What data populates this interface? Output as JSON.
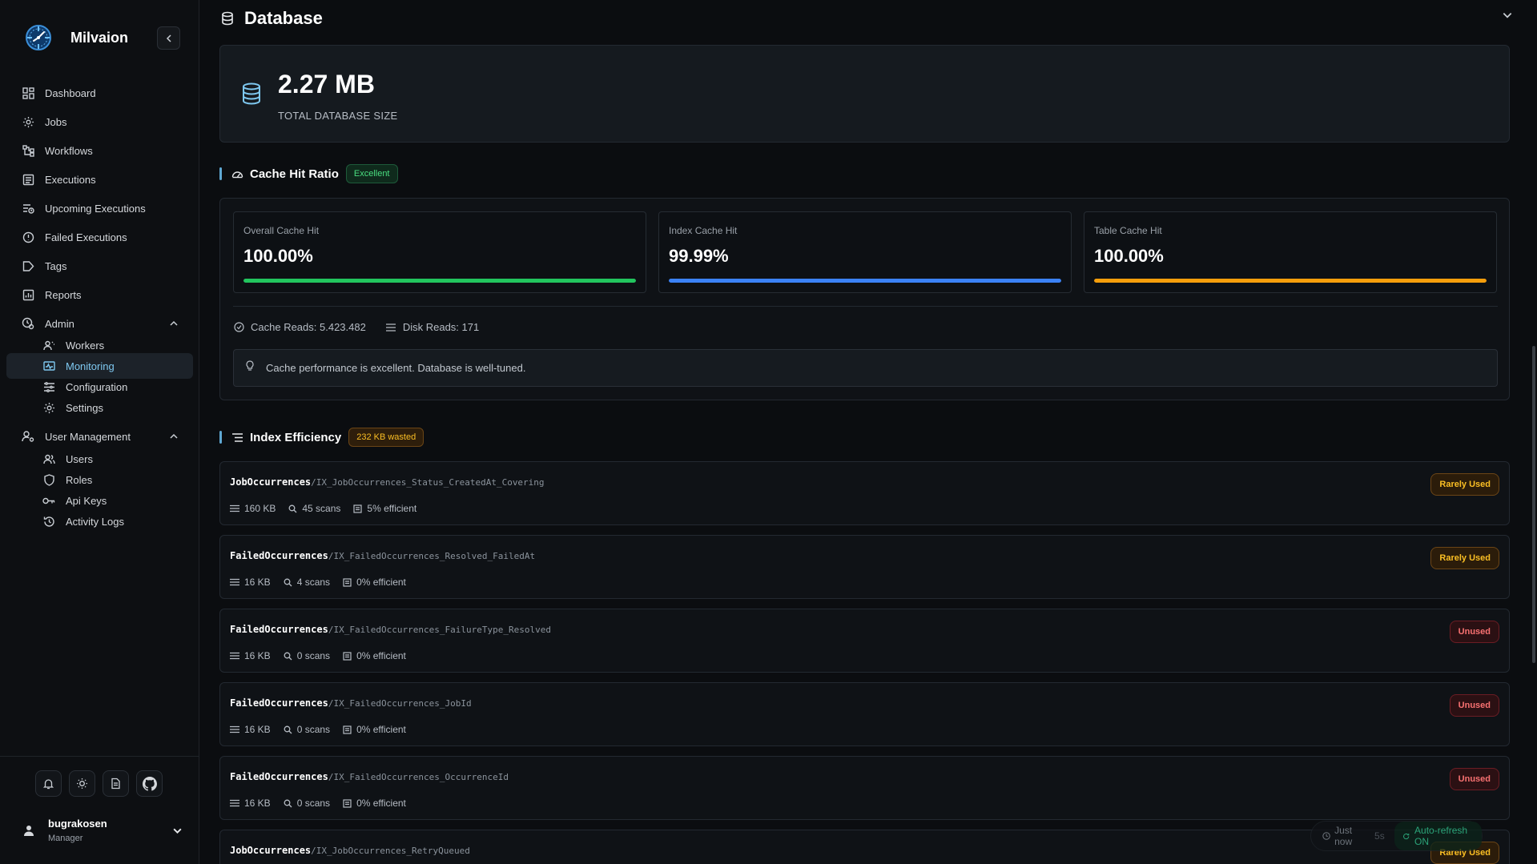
{
  "app": {
    "name": "Milvaion"
  },
  "colors": {
    "accent": "#7ec8f0",
    "success": "#22c55e",
    "info": "#3b82f6",
    "warning": "#f59e0b",
    "danger": "#ef4444"
  },
  "sidebar": {
    "items": [
      {
        "label": "Dashboard",
        "icon": "dashboard-icon"
      },
      {
        "label": "Jobs",
        "icon": "gear-icon"
      },
      {
        "label": "Workflows",
        "icon": "workflow-icon"
      },
      {
        "label": "Executions",
        "icon": "list-icon"
      },
      {
        "label": "Upcoming Executions",
        "icon": "calendar-clock-icon"
      },
      {
        "label": "Failed Executions",
        "icon": "alert-circle-icon"
      },
      {
        "label": "Tags",
        "icon": "tag-icon"
      },
      {
        "label": "Reports",
        "icon": "chart-icon"
      }
    ],
    "admin": {
      "label": "Admin",
      "children": [
        {
          "label": "Workers",
          "icon": "workers-icon"
        },
        {
          "label": "Monitoring",
          "icon": "monitor-icon",
          "active": true
        },
        {
          "label": "Configuration",
          "icon": "sliders-icon"
        },
        {
          "label": "Settings",
          "icon": "gear-icon"
        }
      ]
    },
    "user_management": {
      "label": "User Management",
      "children": [
        {
          "label": "Users",
          "icon": "users-icon"
        },
        {
          "label": "Roles",
          "icon": "shield-icon"
        },
        {
          "label": "Api Keys",
          "icon": "key-icon"
        },
        {
          "label": "Activity Logs",
          "icon": "history-icon"
        }
      ]
    },
    "user": {
      "name": "bugrakosen",
      "role": "Manager"
    }
  },
  "page": {
    "title": "Database"
  },
  "database": {
    "size_value": "2.27 MB",
    "size_label": "TOTAL DATABASE SIZE"
  },
  "cache": {
    "title": "Cache Hit Ratio",
    "badge": "Excellent",
    "metrics": [
      {
        "label": "Overall Cache Hit",
        "value": "100.00%",
        "fill": 1.0,
        "color": "#22c55e"
      },
      {
        "label": "Index Cache Hit",
        "value": "99.99%",
        "fill": 0.9999,
        "color": "#3b82f6"
      },
      {
        "label": "Table Cache Hit",
        "value": "100.00%",
        "fill": 1.0,
        "color": "#f59e0b"
      }
    ],
    "cache_reads": "Cache Reads: 5.423.482",
    "disk_reads": "Disk Reads: 171",
    "tip": "Cache performance is excellent. Database is well-tuned."
  },
  "index_efficiency": {
    "title": "Index Efficiency",
    "badge": "232 KB wasted",
    "rows": [
      {
        "table": "JobOccurrences",
        "index": "/IX_JobOccurrences_Status_CreatedAt_Covering",
        "size": "160 KB",
        "scans": "45 scans",
        "efficiency": "5% efficient",
        "status": "Rarely Used"
      },
      {
        "table": "FailedOccurrences",
        "index": "/IX_FailedOccurrences_Resolved_FailedAt",
        "size": "16 KB",
        "scans": "4 scans",
        "efficiency": "0% efficient",
        "status": "Rarely Used"
      },
      {
        "table": "FailedOccurrences",
        "index": "/IX_FailedOccurrences_FailureType_Resolved",
        "size": "16 KB",
        "scans": "0 scans",
        "efficiency": "0% efficient",
        "status": "Unused"
      },
      {
        "table": "FailedOccurrences",
        "index": "/IX_FailedOccurrences_JobId",
        "size": "16 KB",
        "scans": "0 scans",
        "efficiency": "0% efficient",
        "status": "Unused"
      },
      {
        "table": "FailedOccurrences",
        "index": "/IX_FailedOccurrences_OccurrenceId",
        "size": "16 KB",
        "scans": "0 scans",
        "efficiency": "0% efficient",
        "status": "Unused"
      },
      {
        "table": "JobOccurrences",
        "index": "/IX_JobOccurrences_RetryQueued",
        "size": "",
        "scans": "",
        "efficiency": "",
        "status": "Rarely Used"
      }
    ]
  },
  "refresh": {
    "last_updated": "Just now",
    "interval": "5s",
    "auto": "Auto-refresh ON"
  }
}
